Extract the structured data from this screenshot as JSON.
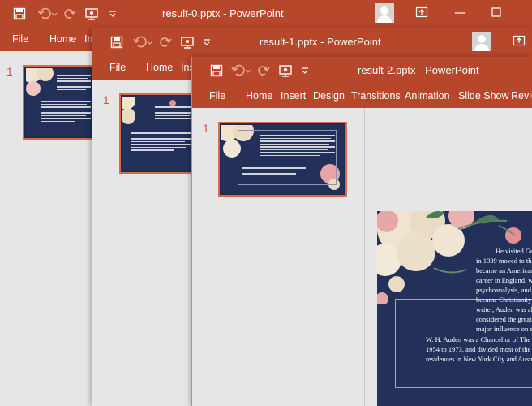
{
  "app": {
    "name": "PowerPoint",
    "accent_color": "#b7472a",
    "background_color": "#e6e6e6",
    "slide_background": "#22305a"
  },
  "windows": [
    {
      "title": "result-0.pptx  -  PowerPoint",
      "tabs": [
        "File",
        "Home",
        "In"
      ],
      "slide_number": "1"
    },
    {
      "title": "result-1.pptx  -  PowerPoint",
      "tabs": [
        "File",
        "Home",
        "Ins"
      ],
      "slide_number": "1"
    },
    {
      "title": "result-2.pptx  -  PowerPoint",
      "tabs": [
        "File",
        "Home",
        "Insert",
        "Design",
        "Transitions",
        "Animation",
        "Slide Show",
        "Revie"
      ],
      "slide_number": "1",
      "slide": {
        "lines": [
          "He visited Ge",
          "in 1939 moved to the",
          "became an American",
          "career in England, wh",
          "psychoanalysis, and h",
          "became Christianity a",
          "writer, Auden was als",
          "considered the greate",
          "major influence on su"
        ],
        "footer_lines": [
          "W. H. Auden was a Chancellor of The Ac",
          "1954 to 1973, and divided most of the se",
          "residences in New York City and Austri"
        ]
      }
    }
  ],
  "icons": [
    "save-icon",
    "undo-icon",
    "redo-icon",
    "present-icon",
    "qat-customize-icon",
    "ribbon-display-icon",
    "minimize-icon",
    "maximize-icon",
    "user-avatar-icon"
  ]
}
